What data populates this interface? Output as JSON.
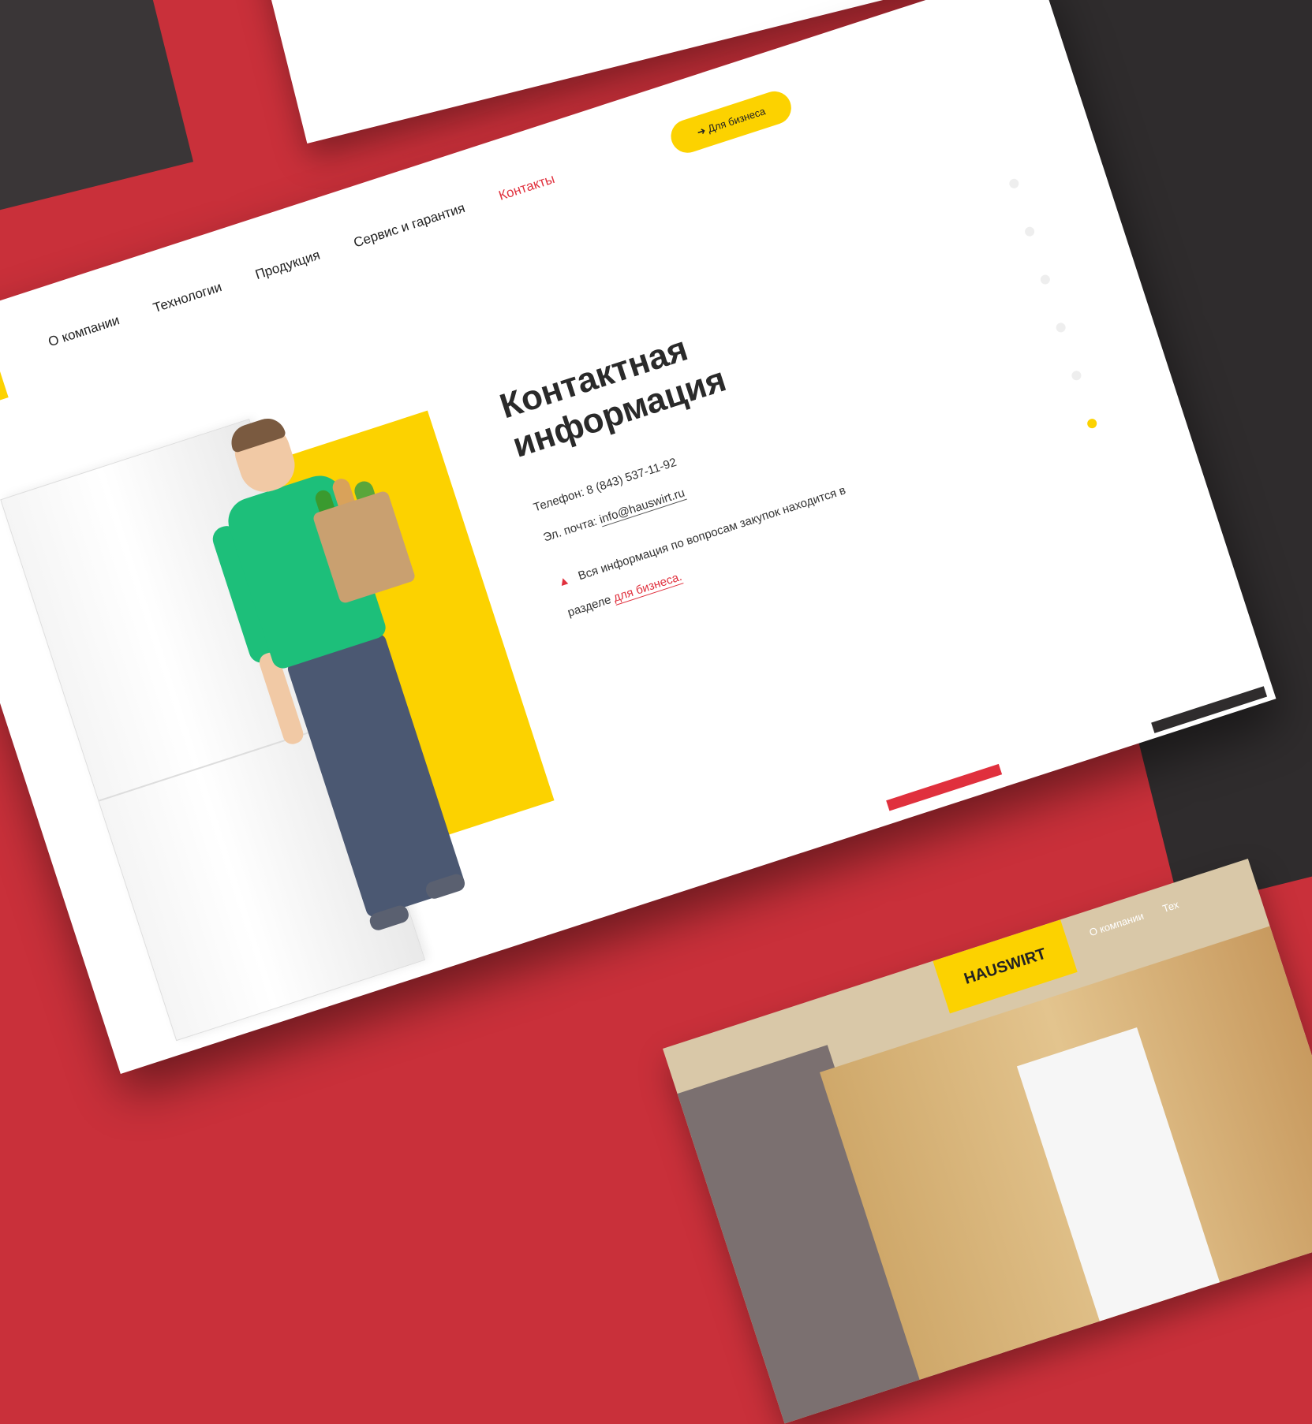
{
  "nav": {
    "items": [
      "О компании",
      "Технологии",
      "Продукция",
      "Сервис и гарантия",
      "Контакты"
    ],
    "active": "Контакты"
  },
  "business_button": {
    "icon": "login-icon",
    "label": "Для бизнеса"
  },
  "contact": {
    "title_line1": "Контактная",
    "title_line2": "информация",
    "phone_label": "Телефон:",
    "phone": "8 (843) 537-11-92",
    "email_label": "Эл. почта:",
    "email": "info@hauswirt.ru",
    "warning_text": "Вся информация по вопросам закупок находится в разделе",
    "warning_link": "для бизнеса.",
    "warning_icon": "warning-icon"
  },
  "pagination": {
    "total": 6,
    "active_index": 5
  },
  "second_page": {
    "logo": "HAUSWIRT",
    "nav": [
      "О компании",
      "Тех"
    ]
  },
  "colors": {
    "background_red": "#c9303a",
    "accent_yellow": "#fcd200",
    "accent_red": "#e0303d",
    "dark": "#2f2c2d",
    "shirt_green": "#1dbf7a"
  }
}
